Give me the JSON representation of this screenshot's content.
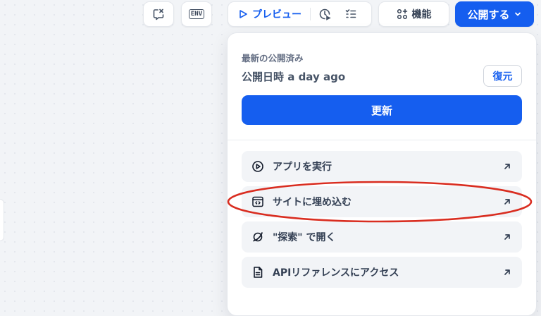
{
  "toolbar": {
    "preview_label": "プレビュー",
    "features_label": "機能",
    "publish_label": "公開する",
    "env_label": "ENV"
  },
  "panel": {
    "latest_label": "最新の公開済み",
    "published_time": "公開日時 a day ago",
    "restore_label": "復元",
    "update_label": "更新",
    "items": [
      {
        "label": "アプリを実行",
        "icon": "play-circle-icon"
      },
      {
        "label": "サイトに埋め込む",
        "icon": "embed-window-icon"
      },
      {
        "label": "\"探索\" で開く",
        "icon": "explore-planet-icon"
      },
      {
        "label": "APIリファレンスにアクセス",
        "icon": "document-icon"
      }
    ]
  },
  "colors": {
    "accent": "#155eef",
    "annotation": "#d92d20"
  }
}
